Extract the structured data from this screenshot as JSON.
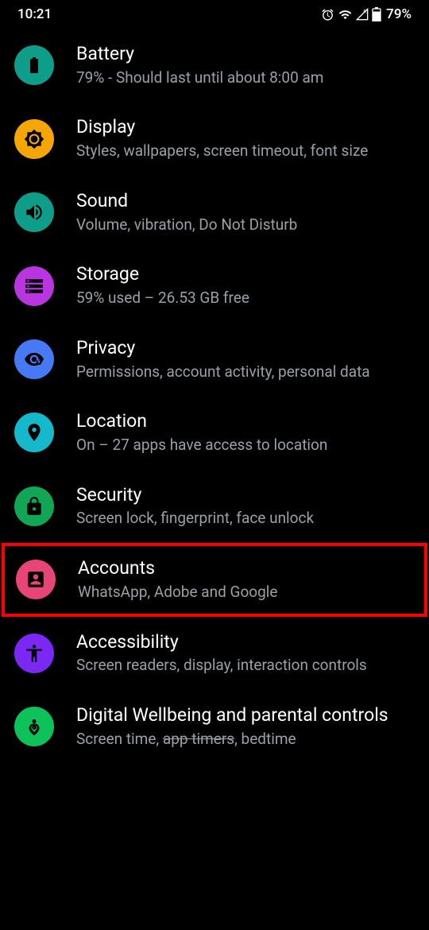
{
  "statusBar": {
    "time": "10:21",
    "battery": "79%"
  },
  "items": [
    {
      "title": "Battery",
      "sub": "79% - Should last until about 8:00 am"
    },
    {
      "title": "Display",
      "sub": "Styles, wallpapers, screen timeout, font size"
    },
    {
      "title": "Sound",
      "sub": "Volume, vibration, Do Not Disturb"
    },
    {
      "title": "Storage",
      "sub": "59% used – 26.53 GB free"
    },
    {
      "title": "Privacy",
      "sub": "Permissions, account activity, personal data"
    },
    {
      "title": "Location",
      "sub": "On – 27 apps have access to location"
    },
    {
      "title": "Security",
      "sub": "Screen lock, fingerprint, face unlock"
    },
    {
      "title": "Accounts",
      "sub": "WhatsApp, Adobe and Google"
    },
    {
      "title": "Accessibility",
      "sub": "Screen readers, display, interaction controls"
    },
    {
      "title": "Digital Wellbeing and parental controls",
      "sub_pre": "Screen time, ",
      "sub_strike": "app timers",
      "sub_post": ", bedtime"
    }
  ]
}
